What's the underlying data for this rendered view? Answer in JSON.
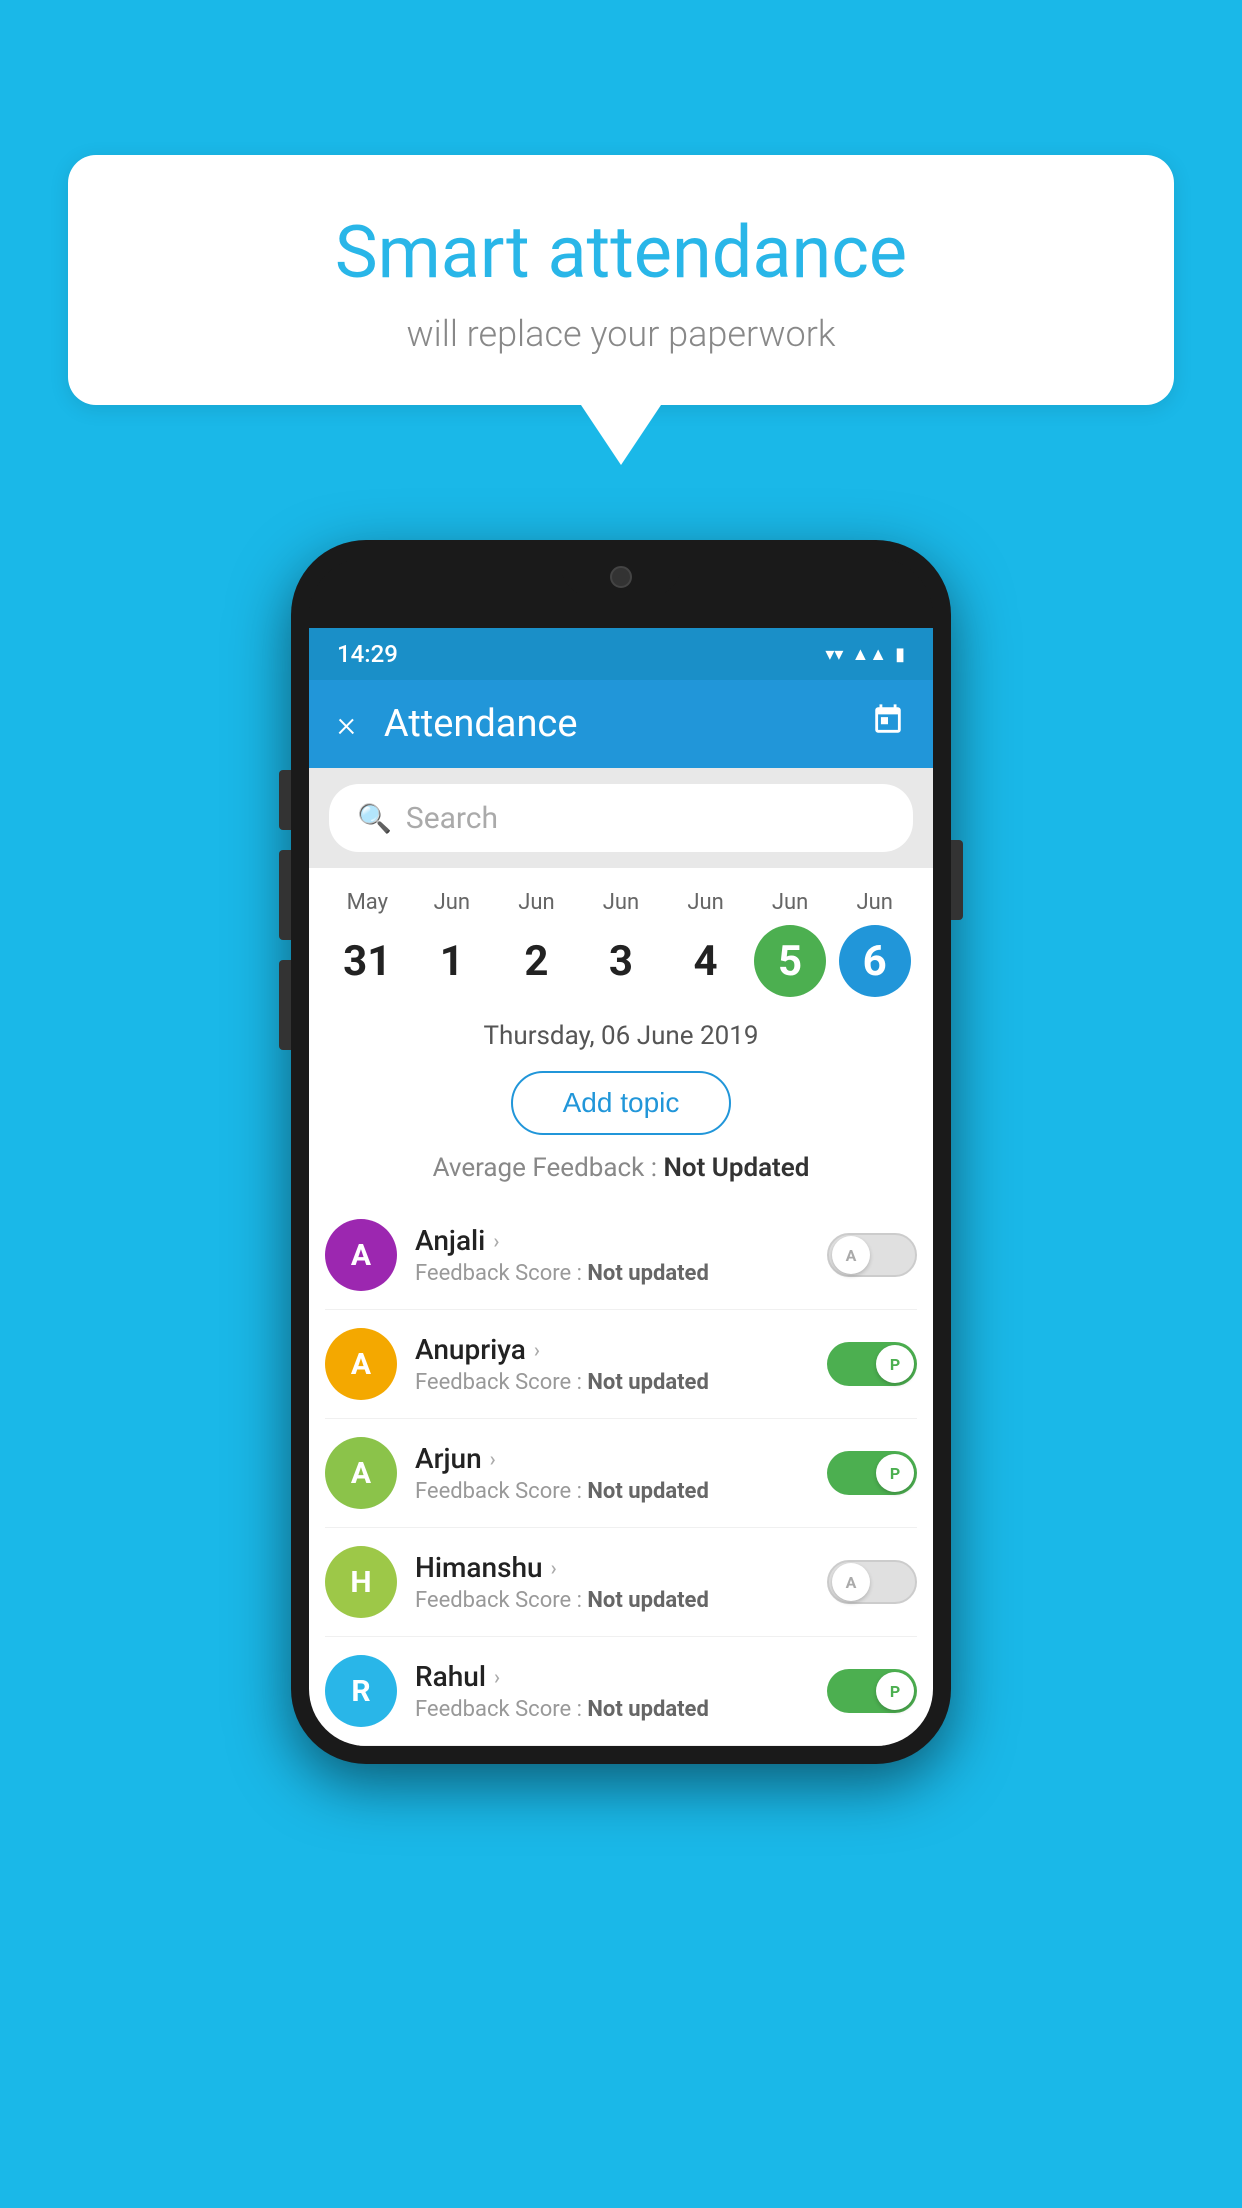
{
  "background": {
    "color": "#1ab8e8"
  },
  "speech_bubble": {
    "title": "Smart attendance",
    "subtitle": "will replace your paperwork"
  },
  "phone": {
    "status_bar": {
      "time": "14:29",
      "icons": [
        "wifi",
        "signal",
        "battery"
      ]
    },
    "header": {
      "close_label": "×",
      "title": "Attendance",
      "calendar_icon": "calendar"
    },
    "search": {
      "placeholder": "Search"
    },
    "calendar": {
      "days": [
        {
          "month": "May",
          "num": "31",
          "state": "normal"
        },
        {
          "month": "Jun",
          "num": "1",
          "state": "normal"
        },
        {
          "month": "Jun",
          "num": "2",
          "state": "normal"
        },
        {
          "month": "Jun",
          "num": "3",
          "state": "normal"
        },
        {
          "month": "Jun",
          "num": "4",
          "state": "normal"
        },
        {
          "month": "Jun",
          "num": "5",
          "state": "today"
        },
        {
          "month": "Jun",
          "num": "6",
          "state": "selected"
        }
      ]
    },
    "selected_date": "Thursday, 06 June 2019",
    "add_topic_label": "Add topic",
    "average_feedback": {
      "label": "Average Feedback : ",
      "value": "Not Updated"
    },
    "students": [
      {
        "name": "Anjali",
        "initial": "A",
        "avatar_color": "#9c27b0",
        "score_label": "Feedback Score : ",
        "score_value": "Not updated",
        "toggle": "off",
        "toggle_letter": "A"
      },
      {
        "name": "Anupriya",
        "initial": "A",
        "avatar_color": "#f4a800",
        "score_label": "Feedback Score : ",
        "score_value": "Not updated",
        "toggle": "on",
        "toggle_letter": "P"
      },
      {
        "name": "Arjun",
        "initial": "A",
        "avatar_color": "#8bc34a",
        "score_label": "Feedback Score : ",
        "score_value": "Not updated",
        "toggle": "on",
        "toggle_letter": "P"
      },
      {
        "name": "Himanshu",
        "initial": "H",
        "avatar_color": "#9dc848",
        "score_label": "Feedback Score : ",
        "score_value": "Not updated",
        "toggle": "off",
        "toggle_letter": "A"
      },
      {
        "name": "Rahul",
        "initial": "R",
        "avatar_color": "#29b6e8",
        "score_label": "Feedback Score : ",
        "score_value": "Not updated",
        "toggle": "on",
        "toggle_letter": "P"
      }
    ]
  }
}
